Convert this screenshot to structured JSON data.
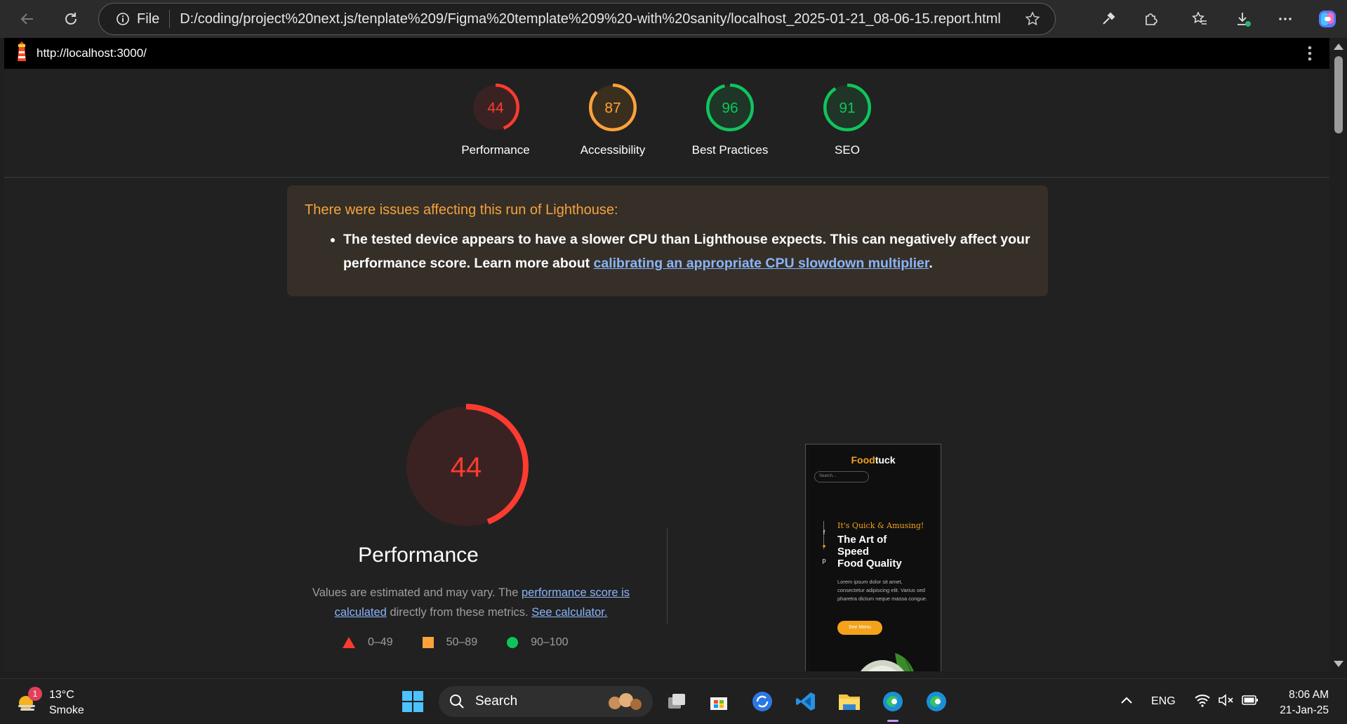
{
  "browser": {
    "address_prefix": "File",
    "address_url": "D:/coding/project%20next.js/tenplate%209/Figma%20template%209%20-with%20sanity/localhost_2025-01-21_08-06-15.report.html"
  },
  "lighthouse": {
    "report_url": "http://localhost:3000/",
    "scores": [
      {
        "label": "Performance",
        "value": "44",
        "score": 0.44,
        "status": "fail"
      },
      {
        "label": "Accessibility",
        "value": "87",
        "score": 0.87,
        "status": "average"
      },
      {
        "label": "Best Practices",
        "value": "96",
        "score": 0.96,
        "status": "pass"
      },
      {
        "label": "SEO",
        "value": "91",
        "score": 0.91,
        "status": "pass"
      }
    ],
    "warning": {
      "title": "There were issues affecting this run of Lighthouse:",
      "item_text": "The tested device appears to have a slower CPU than Lighthouse expects. This can negatively affect your performance score. Learn more about ",
      "item_link": "calibrating an appropriate CPU slowdown multiplier",
      "item_end": "."
    },
    "performance": {
      "score": "44",
      "title": "Performance",
      "desc_start": "Values are estimated and may vary. The ",
      "desc_link": "performance score is calculated",
      "desc_mid": " directly from these metrics. ",
      "desc_link2": "See calculator."
    },
    "legend": [
      {
        "range": "0–49",
        "shape": "triangle"
      },
      {
        "range": "50–89",
        "shape": "square"
      },
      {
        "range": "90–100",
        "shape": "circle"
      }
    ]
  },
  "preview": {
    "brand_a": "Food",
    "brand_b": "tuck",
    "search_placeholder": "Search...",
    "tag": "It's Quick & Amusing!",
    "headline_1": "The Art of",
    "headline_2": "Speed",
    "headline_3": "Food Quality",
    "body": "Lorem ipsum dolor sit amet, consectetur adipiscing elit. Varius sed pharetra dictum neque massa congue.",
    "button": "See Menu"
  },
  "taskbar": {
    "weather_temp": "13°C",
    "weather_desc": "Smoke",
    "weather_badge": "1",
    "search_label": "Search",
    "lang": "ENG",
    "time": "8:06 AM",
    "date": "21-Jan-25"
  },
  "colors": {
    "fail": "#ff3b30",
    "average": "#ffa23a",
    "pass": "#10c45c"
  }
}
